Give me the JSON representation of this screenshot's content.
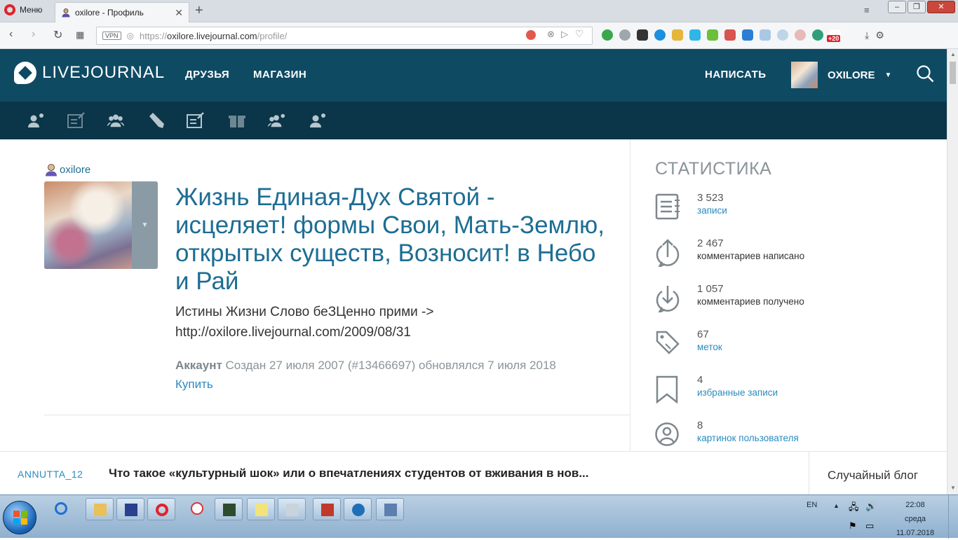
{
  "browser": {
    "menu_label": "Меню",
    "tab_title": "oxilore - Профиль",
    "url_prefix": "https://",
    "url_host": "oxilore.livejournal.com",
    "url_path": "/profile/",
    "vpn_label": "VPN",
    "badge_count": "+20"
  },
  "header": {
    "logo_text": "LIVEJOURNAL",
    "nav_friends": "ДРУЗЬЯ",
    "nav_shop": "МАГАЗИН",
    "write_label": "НАПИСАТЬ",
    "username": "OXILORE"
  },
  "profile": {
    "username": "oxilore",
    "journal_title": "Жизнь Единая-Дух Святой - исцеляет! формы Свои, Мать-Землю, открытых существ, Возносит! в Небо и Рай",
    "journal_subtitle": "Истины Жизни Слово беЗЦенно прими -> http://oxilore.livejournal.com/2009/08/31",
    "account_label": "Аккаунт",
    "account_info": "Создан 27 июля 2007 (#13466697) обновлялся 7 июля 2018",
    "buy_label": "Купить"
  },
  "stats": {
    "title": "СТАТИСТИКА",
    "items": [
      {
        "value": "3 523",
        "label": "записи",
        "link": true,
        "icon": "journal-entries-icon"
      },
      {
        "value": "2 467",
        "label": "комментариев написано",
        "link": false,
        "icon": "comments-written-icon"
      },
      {
        "value": "1 057",
        "label": "комментариев получено",
        "link": false,
        "icon": "comments-received-icon"
      },
      {
        "value": "67",
        "label": "меток",
        "link": true,
        "icon": "tag-icon"
      },
      {
        "value": "4",
        "label": "избранные записи",
        "link": true,
        "icon": "bookmark-icon"
      },
      {
        "value": "8",
        "label": "картинок пользователя",
        "link": true,
        "icon": "userpic-icon"
      }
    ]
  },
  "strip": {
    "user": "ANNUTTA_12",
    "headline": "Что такое «культурный шок» или о впечатлениях студентов от вживания в нов...",
    "random_blog": "Случайный блог"
  },
  "taskbar": {
    "lang": "EN",
    "time": "22:08",
    "day": "среда",
    "date": "11.07.2018"
  },
  "colors": {
    "header_bg": "#0f4a63",
    "subbar_bg": "#0b3548",
    "link": "#1d6d93",
    "accent_link": "#2a8bbf"
  }
}
